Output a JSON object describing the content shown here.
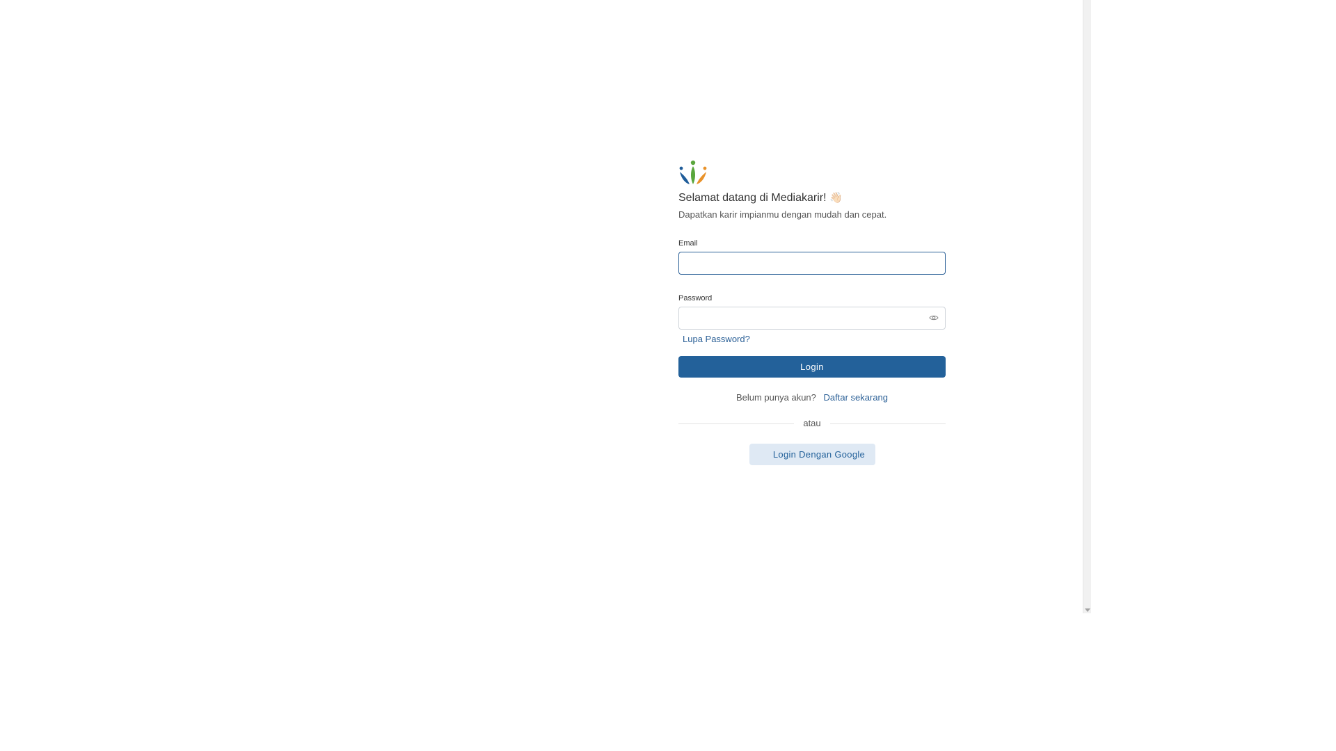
{
  "brand": {
    "logo_icon": "mediakarir-logo-icon",
    "colors": {
      "blue": "#1f5c99",
      "green": "#5aa63c",
      "orange": "#e9922a"
    }
  },
  "welcome": {
    "title": "Selamat datang di Mediakarir!",
    "emoji": "👋🏻",
    "subtitle": "Dapatkan karir impianmu dengan mudah dan cepat."
  },
  "form": {
    "email_label": "Email",
    "email_value": "",
    "password_label": "Password",
    "password_value": "",
    "password_toggle_icon": "eye-icon",
    "forgot_password": "Lupa Password?",
    "login_button": "Login"
  },
  "register": {
    "question": "Belum punya akun?",
    "link": "Daftar sekarang"
  },
  "divider_text": "atau",
  "google_login": "Login Dengan Google",
  "theme": {
    "primary": "#23619a",
    "google_bg": "#dfe9f4"
  }
}
